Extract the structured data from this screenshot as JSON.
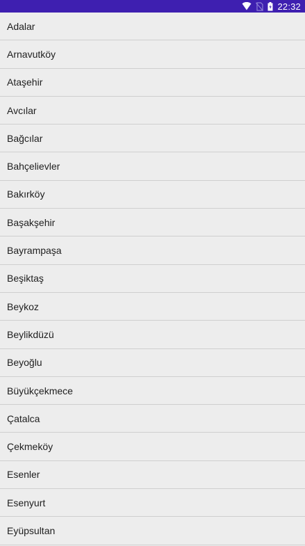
{
  "status_bar": {
    "time": "22:32",
    "icons": [
      "wifi-icon",
      "no-sim-icon",
      "battery-icon"
    ]
  },
  "districts": [
    "Adalar",
    "Arnavutköy",
    "Ataşehir",
    "Avcılar",
    "Bağcılar",
    "Bahçelievler",
    "Bakırköy",
    "Başakşehir",
    "Bayrampaşa",
    "Beşiktaş",
    "Beykoz",
    "Beylikdüzü",
    "Beyoğlu",
    "Büyükçekmece",
    "Çatalca",
    "Çekmeköy",
    "Esenler",
    "Esenyurt",
    "Eyüpsultan"
  ]
}
